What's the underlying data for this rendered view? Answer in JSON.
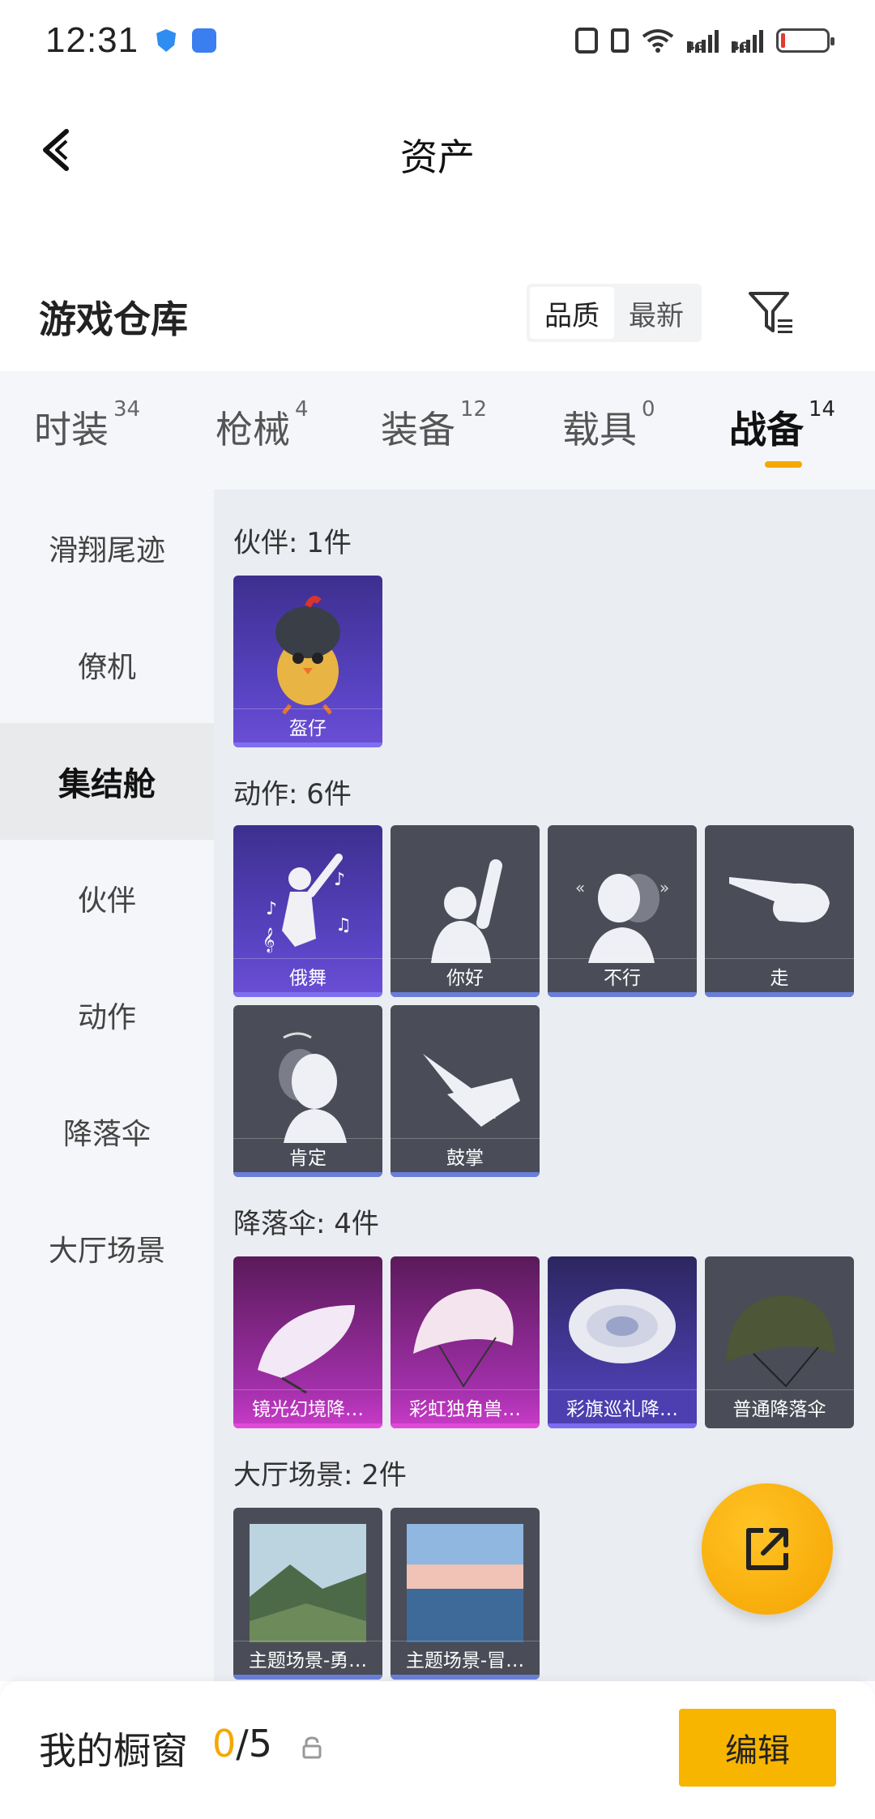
{
  "status_bar": {
    "time": "12:31",
    "net1": "4G",
    "net2": "4G"
  },
  "header": {
    "title": "资产"
  },
  "warehouse": {
    "title": "游戏仓库",
    "sort_options": [
      "品质",
      "最新"
    ],
    "sort_selected": "品质"
  },
  "tabs": [
    {
      "label": "时装",
      "count": "34"
    },
    {
      "label": "枪械",
      "count": "4"
    },
    {
      "label": "装备",
      "count": "12"
    },
    {
      "label": "载具",
      "count": "0"
    },
    {
      "label": "战备",
      "count": "14",
      "active": true
    }
  ],
  "sidebar": {
    "items": [
      "滑翔尾迹",
      "僚机",
      "集结舱",
      "伙伴",
      "动作",
      "降落伞",
      "大厅场景"
    ],
    "active": "集结舱"
  },
  "groups": [
    {
      "title": "伙伴: 1件",
      "items": [
        "盔仔"
      ]
    },
    {
      "title": "动作: 6件",
      "items": [
        "俄舞",
        "你好",
        "不行",
        "走",
        "肯定",
        "鼓掌"
      ]
    },
    {
      "title": "降落伞: 4件",
      "items": [
        "镜光幻境降…",
        "彩虹独角兽…",
        "彩旗巡礼降…",
        "普通降落伞"
      ]
    },
    {
      "title": "大厅场景: 2件",
      "items": [
        "主题场景-勇…",
        "主题场景-冒…"
      ]
    }
  ],
  "bottom": {
    "showcase_label": "我的橱窗",
    "showcase_current": "0",
    "showcase_total": "/5",
    "edit_label": "编辑"
  },
  "colors": {
    "accent": "#f5a800",
    "tab_bg": "#f4f6f9",
    "content_bg": "#eaedf2"
  }
}
